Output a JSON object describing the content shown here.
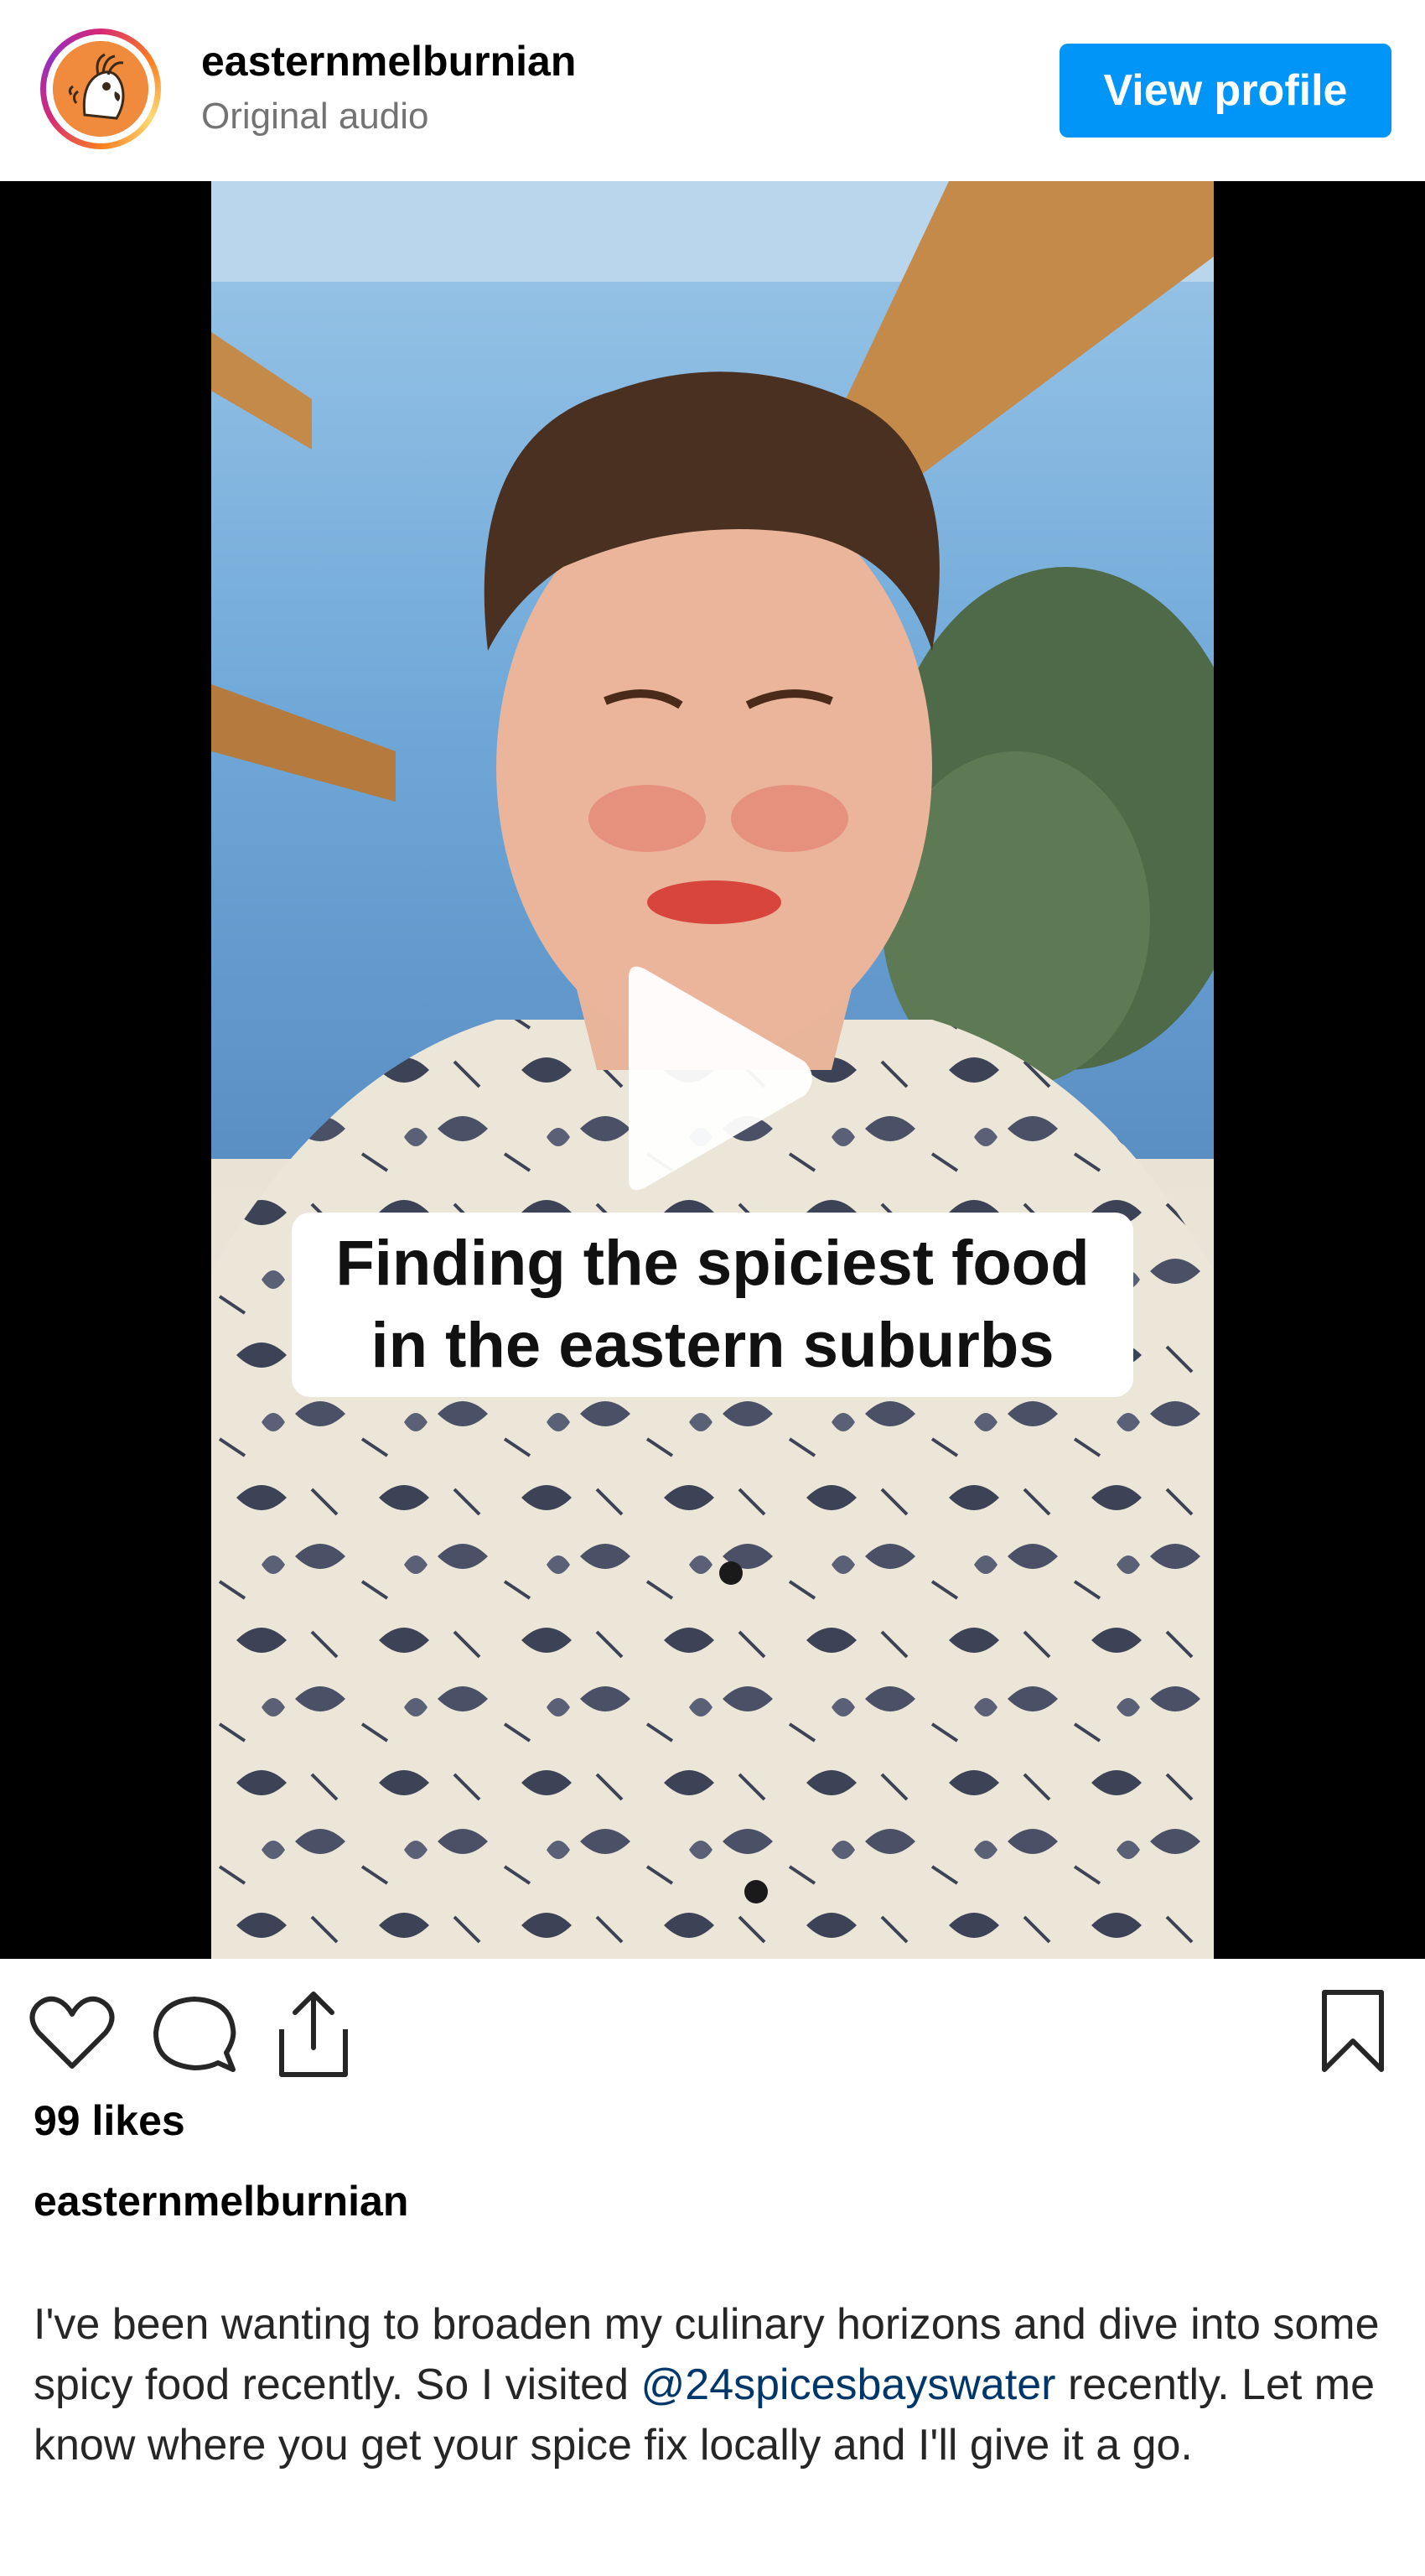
{
  "post": {
    "username": "easternmelburnian",
    "audio": "Original audio",
    "view_profile_label": "View profile"
  },
  "video": {
    "overlay_line1": "Finding the spiciest food",
    "overlay_line2": "in the eastern suburbs",
    "state": "paused"
  },
  "engagement": {
    "likes": "99 likes"
  },
  "caption": {
    "username": "easternmelburnian",
    "text_before": "I've been wanting to broaden my culinary horizons and dive into some spicy food recently. So I visited ",
    "mention": "@24spicesbayswater",
    "text_after": " recently. Let me know where you get your spice fix locally and I'll give it a go."
  },
  "colors": {
    "accent": "#0095f6",
    "mention": "#00376b",
    "secondary_text": "#737373"
  },
  "icons": [
    "heart-icon",
    "comment-icon",
    "share-icon",
    "bookmark-icon",
    "play-icon"
  ]
}
